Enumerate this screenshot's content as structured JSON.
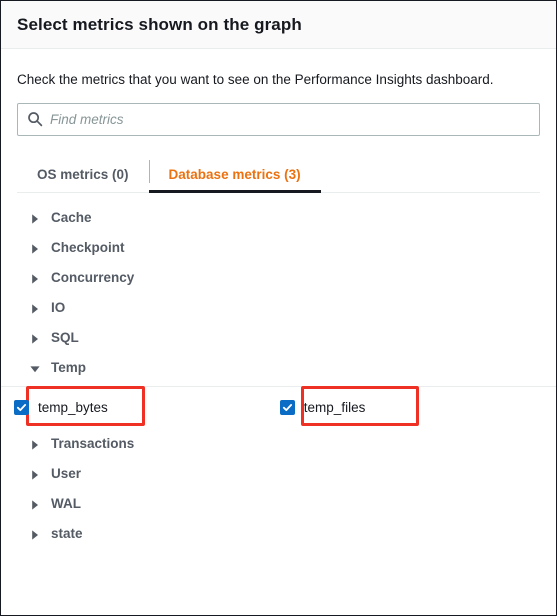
{
  "dialog": {
    "title": "Select metrics shown on the graph",
    "instruction": "Check the metrics that you want to see on the Performance Insights dashboard."
  },
  "search": {
    "placeholder": "Find metrics",
    "value": "",
    "icon": "search-icon"
  },
  "tabs": [
    {
      "label": "OS metrics (0)",
      "active": false
    },
    {
      "label": "Database metrics (3)",
      "active": true
    }
  ],
  "tree": {
    "groups_before": [
      {
        "label": "Cache",
        "expanded": false,
        "icon": "caret-right-icon"
      },
      {
        "label": "Checkpoint",
        "expanded": false,
        "icon": "caret-right-icon"
      },
      {
        "label": "Concurrency",
        "expanded": false,
        "icon": "caret-right-icon"
      },
      {
        "label": "IO",
        "expanded": false,
        "icon": "caret-right-icon"
      },
      {
        "label": "SQL",
        "expanded": false,
        "icon": "caret-right-icon"
      }
    ],
    "expanded_group": {
      "label": "Temp",
      "expanded": true,
      "icon": "caret-down-icon",
      "metrics": [
        {
          "label": "temp_bytes",
          "checked": true,
          "highlighted": true
        },
        {
          "label": "temp_files",
          "checked": true,
          "highlighted": true
        }
      ]
    },
    "groups_after": [
      {
        "label": "Transactions",
        "expanded": false,
        "icon": "caret-right-icon"
      },
      {
        "label": "User",
        "expanded": false,
        "icon": "caret-right-icon"
      },
      {
        "label": "WAL",
        "expanded": false,
        "icon": "caret-right-icon"
      },
      {
        "label": "state",
        "expanded": false,
        "icon": "caret-right-icon"
      }
    ]
  },
  "colors": {
    "accent_orange": "#ec7211",
    "checkbox_blue": "#0a6cc4",
    "annotation_red": "#ee3124",
    "header_bg": "#fafafa",
    "text_dark": "#16191f",
    "text_muted": "#545b64"
  }
}
